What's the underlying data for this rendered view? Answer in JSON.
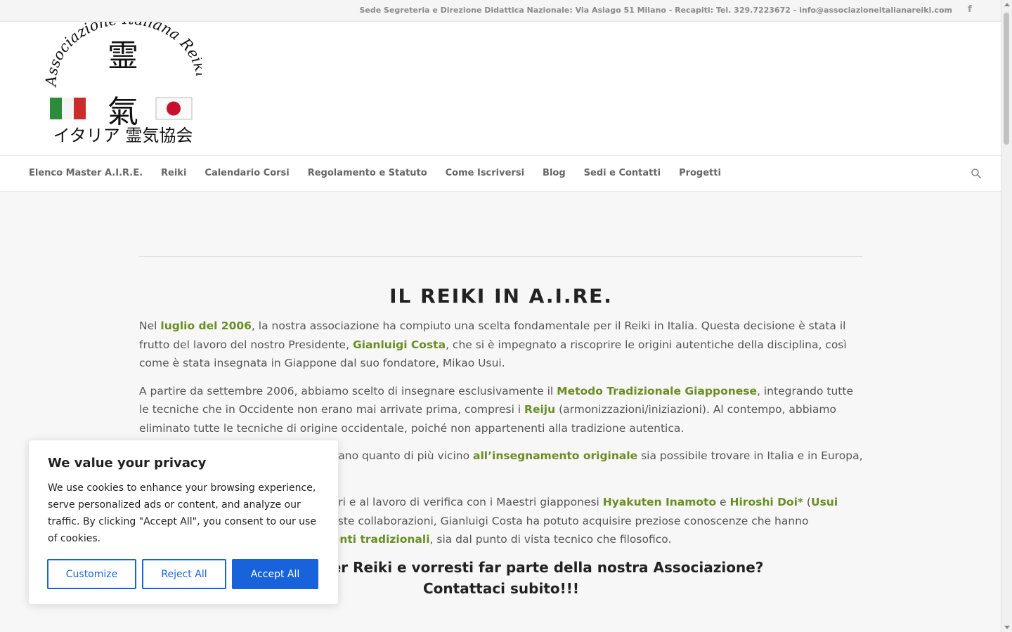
{
  "topbar": {
    "info": "Sede Segreteria e Direzione Didattica Nazionale: Via Asiago 51 Milano - Recapiti: Tel. 329.7223672 - info@associazioneitalianareiki.com",
    "facebook_glyph": "f"
  },
  "logo": {
    "arc_text": "Associazione Italiana Reiki",
    "kanji_top": "霊",
    "kanji_bottom": "氣",
    "japanese_text": "イタリア 霊気協会"
  },
  "nav": {
    "items": [
      {
        "label": "Elenco Master A.I.R.E."
      },
      {
        "label": "Reiki"
      },
      {
        "label": "Calendario Corsi"
      },
      {
        "label": "Regolamento e Statuto"
      },
      {
        "label": "Come Iscriversi"
      },
      {
        "label": "Blog"
      },
      {
        "label": "Sedi e Contatti"
      },
      {
        "label": "Progetti"
      }
    ]
  },
  "main": {
    "title": "IL REIKI IN A.I.RE.",
    "p1": {
      "a": "Nel ",
      "b": "luglio del 2006",
      "c": ", la nostra associazione ha compiuto una scelta fondamentale per il Reiki in Italia. Questa decisione è stata il frutto del lavoro del nostro Presidente, ",
      "d": "Gianluigi Costa",
      "e": ", che si è impegnato a riscoprire le origini autentiche della disciplina, così come è stata insegnata in Giappone dal suo fondatore, Mikao Usui."
    },
    "p2": {
      "a": "A partire da settembre 2006, abbiamo scelto di insegnare esclusivamente il ",
      "b": "Metodo Tradizionale Giapponese",
      "c": ", integrando tutte le tecniche che in Occidente non erano mai arrivate prima, compresi i ",
      "d": "Reiju",
      "e": " (armonizzazioni/iniziazioni). Al contempo, abbiamo eliminato tutte le tecniche di origine occidentale, poiché non appartenenti alla tradizione autentica."
    },
    "p3": {
      "a": "I corsi proposti da A.I.RE. rappresentano quanto di più vicino ",
      "b": "all’insegnamento originale",
      "c": " sia possibile trovare in Italia e in Europa, attualmente."
    },
    "p4": {
      "a": "Questo risultato è dovuto agli incontri e al lavoro di verifica con i Maestri giapponesi ",
      "b": "Hyakuten Inamoto",
      "c": " e ",
      "d": "Hiroshi Doi*",
      "e": " (",
      "f": "Usui Reiki Ryoho Gakkai)",
      "g": ". Grazie a queste collaborazioni, Gianluigi Costa ha potuto acquisire preziose conoscenze che hanno permesso di risalire agli ",
      "h": "insegnamenti tradizionali",
      "i": ", sia dal punto di vista tecnico che filosofico."
    },
    "cta_line1": "Sei un Master Reiki e vorresti far parte della nostra Associazione?",
    "cta_line2": "Contattaci subito!!!"
  },
  "cookie": {
    "title": "We value your privacy",
    "text": "We use cookies to enhance your browsing experience, serve personalized ads or content, and analyze our traffic. By clicking \"Accept All\", you consent to our use of cookies.",
    "customize": "Customize",
    "reject": "Reject All",
    "accept": "Accept All"
  },
  "colors": {
    "accent_green": "#6a8e23",
    "button_blue": "#1863dc"
  },
  "icons": {
    "search": "search-icon",
    "facebook": "facebook-icon"
  }
}
